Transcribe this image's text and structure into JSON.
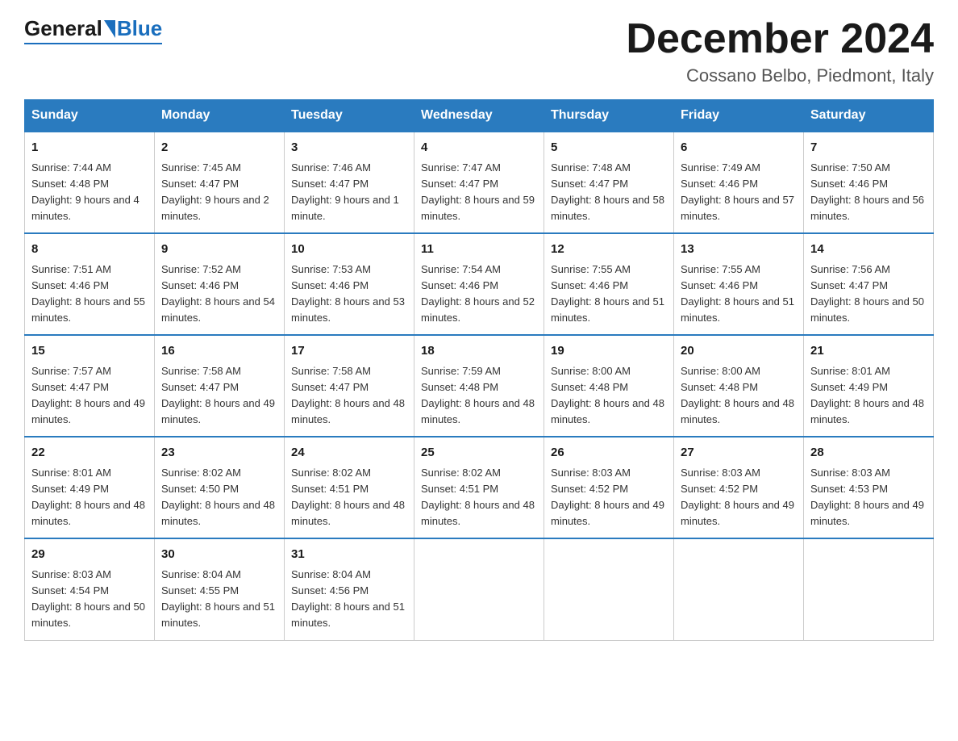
{
  "header": {
    "logo": {
      "general": "General",
      "blue": "Blue"
    },
    "title": "December 2024",
    "location": "Cossano Belbo, Piedmont, Italy"
  },
  "weekdays": [
    "Sunday",
    "Monday",
    "Tuesday",
    "Wednesday",
    "Thursday",
    "Friday",
    "Saturday"
  ],
  "weeks": [
    [
      {
        "day": "1",
        "sunrise": "7:44 AM",
        "sunset": "4:48 PM",
        "daylight": "9 hours and 4 minutes."
      },
      {
        "day": "2",
        "sunrise": "7:45 AM",
        "sunset": "4:47 PM",
        "daylight": "9 hours and 2 minutes."
      },
      {
        "day": "3",
        "sunrise": "7:46 AM",
        "sunset": "4:47 PM",
        "daylight": "9 hours and 1 minute."
      },
      {
        "day": "4",
        "sunrise": "7:47 AM",
        "sunset": "4:47 PM",
        "daylight": "8 hours and 59 minutes."
      },
      {
        "day": "5",
        "sunrise": "7:48 AM",
        "sunset": "4:47 PM",
        "daylight": "8 hours and 58 minutes."
      },
      {
        "day": "6",
        "sunrise": "7:49 AM",
        "sunset": "4:46 PM",
        "daylight": "8 hours and 57 minutes."
      },
      {
        "day": "7",
        "sunrise": "7:50 AM",
        "sunset": "4:46 PM",
        "daylight": "8 hours and 56 minutes."
      }
    ],
    [
      {
        "day": "8",
        "sunrise": "7:51 AM",
        "sunset": "4:46 PM",
        "daylight": "8 hours and 55 minutes."
      },
      {
        "day": "9",
        "sunrise": "7:52 AM",
        "sunset": "4:46 PM",
        "daylight": "8 hours and 54 minutes."
      },
      {
        "day": "10",
        "sunrise": "7:53 AM",
        "sunset": "4:46 PM",
        "daylight": "8 hours and 53 minutes."
      },
      {
        "day": "11",
        "sunrise": "7:54 AM",
        "sunset": "4:46 PM",
        "daylight": "8 hours and 52 minutes."
      },
      {
        "day": "12",
        "sunrise": "7:55 AM",
        "sunset": "4:46 PM",
        "daylight": "8 hours and 51 minutes."
      },
      {
        "day": "13",
        "sunrise": "7:55 AM",
        "sunset": "4:46 PM",
        "daylight": "8 hours and 51 minutes."
      },
      {
        "day": "14",
        "sunrise": "7:56 AM",
        "sunset": "4:47 PM",
        "daylight": "8 hours and 50 minutes."
      }
    ],
    [
      {
        "day": "15",
        "sunrise": "7:57 AM",
        "sunset": "4:47 PM",
        "daylight": "8 hours and 49 minutes."
      },
      {
        "day": "16",
        "sunrise": "7:58 AM",
        "sunset": "4:47 PM",
        "daylight": "8 hours and 49 minutes."
      },
      {
        "day": "17",
        "sunrise": "7:58 AM",
        "sunset": "4:47 PM",
        "daylight": "8 hours and 48 minutes."
      },
      {
        "day": "18",
        "sunrise": "7:59 AM",
        "sunset": "4:48 PM",
        "daylight": "8 hours and 48 minutes."
      },
      {
        "day": "19",
        "sunrise": "8:00 AM",
        "sunset": "4:48 PM",
        "daylight": "8 hours and 48 minutes."
      },
      {
        "day": "20",
        "sunrise": "8:00 AM",
        "sunset": "4:48 PM",
        "daylight": "8 hours and 48 minutes."
      },
      {
        "day": "21",
        "sunrise": "8:01 AM",
        "sunset": "4:49 PM",
        "daylight": "8 hours and 48 minutes."
      }
    ],
    [
      {
        "day": "22",
        "sunrise": "8:01 AM",
        "sunset": "4:49 PM",
        "daylight": "8 hours and 48 minutes."
      },
      {
        "day": "23",
        "sunrise": "8:02 AM",
        "sunset": "4:50 PM",
        "daylight": "8 hours and 48 minutes."
      },
      {
        "day": "24",
        "sunrise": "8:02 AM",
        "sunset": "4:51 PM",
        "daylight": "8 hours and 48 minutes."
      },
      {
        "day": "25",
        "sunrise": "8:02 AM",
        "sunset": "4:51 PM",
        "daylight": "8 hours and 48 minutes."
      },
      {
        "day": "26",
        "sunrise": "8:03 AM",
        "sunset": "4:52 PM",
        "daylight": "8 hours and 49 minutes."
      },
      {
        "day": "27",
        "sunrise": "8:03 AM",
        "sunset": "4:52 PM",
        "daylight": "8 hours and 49 minutes."
      },
      {
        "day": "28",
        "sunrise": "8:03 AM",
        "sunset": "4:53 PM",
        "daylight": "8 hours and 49 minutes."
      }
    ],
    [
      {
        "day": "29",
        "sunrise": "8:03 AM",
        "sunset": "4:54 PM",
        "daylight": "8 hours and 50 minutes."
      },
      {
        "day": "30",
        "sunrise": "8:04 AM",
        "sunset": "4:55 PM",
        "daylight": "8 hours and 51 minutes."
      },
      {
        "day": "31",
        "sunrise": "8:04 AM",
        "sunset": "4:56 PM",
        "daylight": "8 hours and 51 minutes."
      },
      null,
      null,
      null,
      null
    ]
  ],
  "labels": {
    "sunrise": "Sunrise:",
    "sunset": "Sunset:",
    "daylight": "Daylight:"
  }
}
